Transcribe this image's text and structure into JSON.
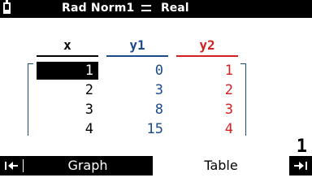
{
  "status": {
    "mode": "Rad Norm1",
    "number_format": "Real",
    "battery_icon": "battery-icon",
    "real_icon": "equals-icon"
  },
  "table": {
    "headers": {
      "x": "x",
      "y1": "y1",
      "y2": "y2"
    },
    "rows": [
      {
        "x": "1",
        "y1": "0",
        "y2": "1"
      },
      {
        "x": "2",
        "y1": "3",
        "y2": "2"
      },
      {
        "x": "3",
        "y1": "8",
        "y2": "3"
      },
      {
        "x": "4",
        "y1": "15",
        "y2": "4"
      }
    ],
    "selected_row": 1,
    "colors": {
      "y1": "#1a4c8c",
      "y2": "#d42020"
    }
  },
  "page_indicator": "1",
  "bottom_bar": {
    "left_icon": "←",
    "graph_label": "Graph",
    "table_label": "Table",
    "right_icon": "→"
  }
}
